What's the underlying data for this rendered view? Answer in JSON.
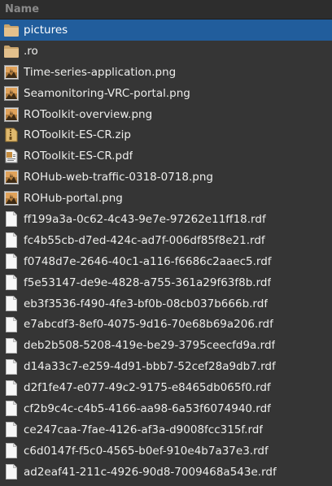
{
  "header": {
    "name_label": "Name"
  },
  "colors": {
    "background": "#353535",
    "header_bg": "#2d2d2d",
    "selection": "#215d9c",
    "text": "#eeeeec",
    "folder": "#d8b27a"
  },
  "files": [
    {
      "name": "pictures",
      "icon": "folder-icon",
      "selected": true
    },
    {
      "name": ".ro",
      "icon": "folder-icon",
      "selected": false
    },
    {
      "name": "Time-series-application.png",
      "icon": "image-icon",
      "selected": false
    },
    {
      "name": "Seamonitoring-VRC-portal.png",
      "icon": "image-icon",
      "selected": false
    },
    {
      "name": "ROToolkit-overview.png",
      "icon": "image-icon",
      "selected": false
    },
    {
      "name": "ROToolkit-ES-CR.zip",
      "icon": "archive-icon",
      "selected": false
    },
    {
      "name": "ROToolkit-ES-CR.pdf",
      "icon": "pdf-icon",
      "selected": false
    },
    {
      "name": "ROHub-web-traffic-0318-0718.png",
      "icon": "image-icon",
      "selected": false
    },
    {
      "name": "ROHub-portal.png",
      "icon": "image-icon",
      "selected": false
    },
    {
      "name": "ff199a3a-0c62-4c43-9e7e-97262e11ff18.rdf",
      "icon": "document-icon",
      "selected": false
    },
    {
      "name": "fc4b55cb-d7ed-424c-ad7f-006df85f8e21.rdf",
      "icon": "document-icon",
      "selected": false
    },
    {
      "name": "f0748d7e-2646-40c1-a116-f6686c2aaec5.rdf",
      "icon": "document-icon",
      "selected": false
    },
    {
      "name": "f5e53147-de9e-4828-a755-361a29f63f8b.rdf",
      "icon": "document-icon",
      "selected": false
    },
    {
      "name": "eb3f3536-f490-4fe3-bf0b-08cb037b666b.rdf",
      "icon": "document-icon",
      "selected": false
    },
    {
      "name": "e7abcdf3-8ef0-4075-9d16-70e68b69a206.rdf",
      "icon": "document-icon",
      "selected": false
    },
    {
      "name": "deb2b508-5208-419e-be29-3795ceecfd9a.rdf",
      "icon": "document-icon",
      "selected": false
    },
    {
      "name": "d14a33c7-e259-4d91-bbb7-52cef28a9db7.rdf",
      "icon": "document-icon",
      "selected": false
    },
    {
      "name": "d2f1fe47-e077-49c2-9175-e8465db065f0.rdf",
      "icon": "document-icon",
      "selected": false
    },
    {
      "name": "cf2b9c4c-c4b5-4166-aa98-6a53f6074940.rdf",
      "icon": "document-icon",
      "selected": false
    },
    {
      "name": "ce247caa-7fae-4126-af3a-d9008fcc315f.rdf",
      "icon": "document-icon",
      "selected": false
    },
    {
      "name": "c6d0147f-f5c0-4565-b0ef-910e4b7a37e3.rdf",
      "icon": "document-icon",
      "selected": false
    },
    {
      "name": "ad2eaf41-211c-4926-90d8-7009468a543e.rdf",
      "icon": "document-icon",
      "selected": false
    }
  ]
}
